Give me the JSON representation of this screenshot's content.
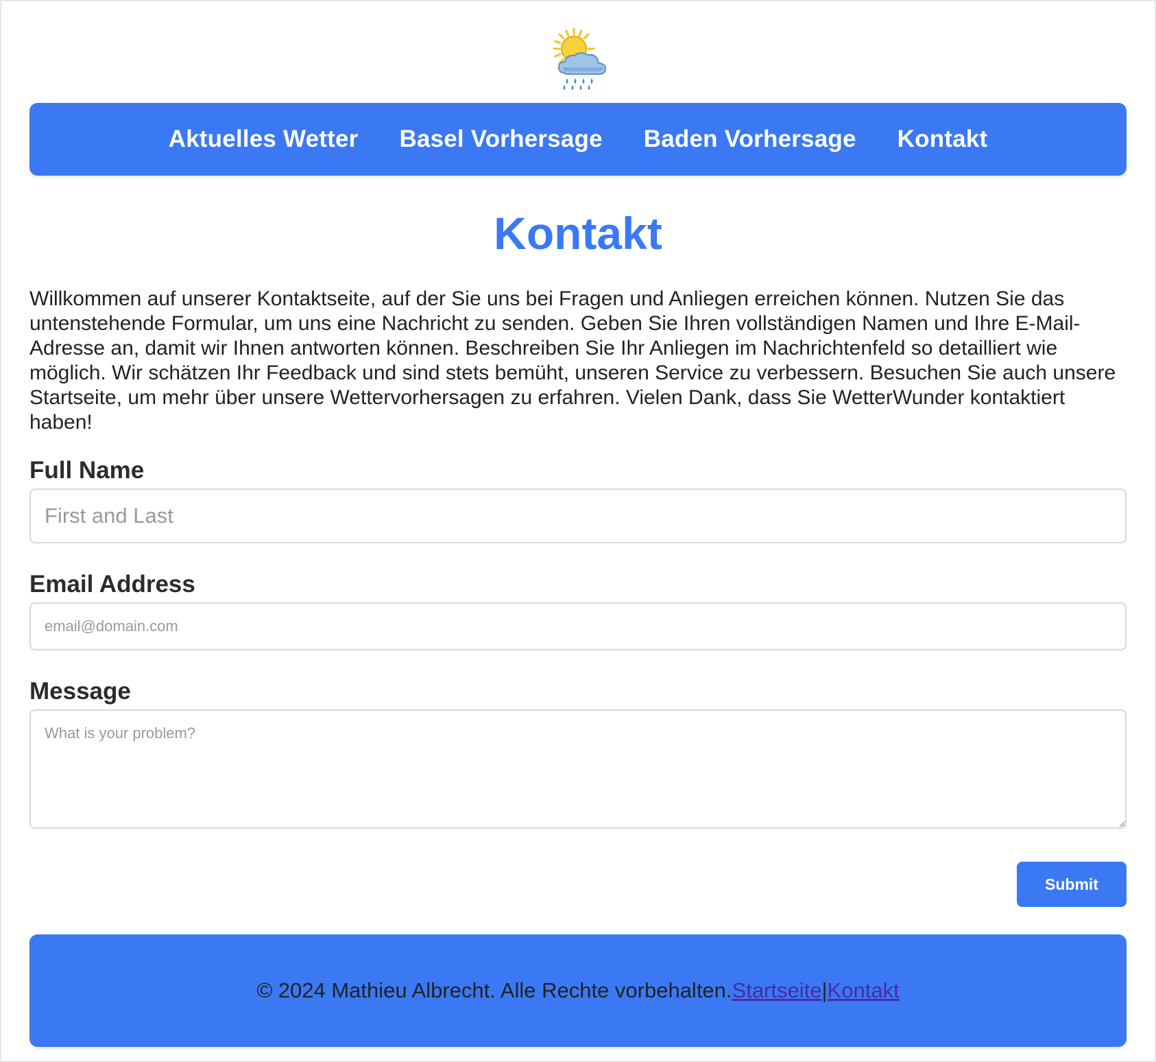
{
  "logo": {
    "icon": "sun-behind-rain-cloud-icon"
  },
  "nav": {
    "items": [
      {
        "label": "Aktuelles Wetter"
      },
      {
        "label": "Basel Vorhersage"
      },
      {
        "label": "Baden Vorhersage"
      },
      {
        "label": "Kontakt"
      }
    ]
  },
  "main": {
    "title": "Kontakt",
    "intro": "Willkommen auf unserer Kontaktseite, auf der Sie uns bei Fragen und Anliegen erreichen können. Nutzen Sie das untenstehende Formular, um uns eine Nachricht zu senden. Geben Sie Ihren vollständigen Namen und Ihre E-Mail-Adresse an, damit wir Ihnen antworten können. Beschreiben Sie Ihr Anliegen im Nachrichtenfeld so detailliert wie möglich. Wir schätzen Ihr Feedback und sind stets bemüht, unseren Service zu verbessern. Besuchen Sie auch unsere Startseite, um mehr über unsere Wettervorhersagen zu erfahren. Vielen Dank, dass Sie WetterWunder kontaktiert haben!"
  },
  "form": {
    "name_label": "Full Name",
    "name_value": "",
    "name_placeholder": "First and Last",
    "email_label": "Email Address",
    "email_value": "",
    "email_placeholder": "email@domain.com",
    "message_label": "Message",
    "message_value": "",
    "message_placeholder": "What is your problem?",
    "submit_label": "Submit"
  },
  "footer": {
    "copyright": "© 2024 Mathieu Albrecht. Alle Rechte vorbehalten.",
    "link_home": "Startseite",
    "separator": "|",
    "link_contact": "Kontakt"
  },
  "colors": {
    "accent": "#3a79f3",
    "link_visited": "#4a2aa8",
    "text": "#222222"
  }
}
